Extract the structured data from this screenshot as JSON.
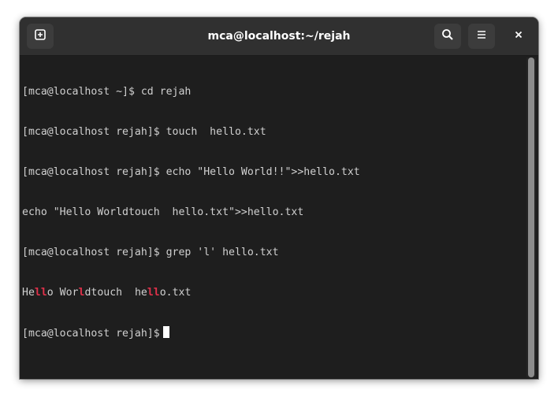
{
  "window": {
    "title": "mca@localhost:~/rejah"
  },
  "toolbar": {
    "new_tab_icon": "new-tab-icon",
    "search_icon": "search-icon",
    "menu_icon": "hamburger-menu-icon",
    "close_icon": "close-icon"
  },
  "terminal": {
    "lines": [
      "[mca@localhost ~]$ cd rejah",
      "[mca@localhost rejah]$ touch  hello.txt",
      "[mca@localhost rejah]$ echo \"Hello World!!\">>hello.txt",
      "echo \"Hello Worldtouch  hello.txt\">>hello.txt",
      "[mca@localhost rejah]$ grep 'l' hello.txt"
    ],
    "grep_result": {
      "p1": "He",
      "m1": "ll",
      "p2": "o Wor",
      "m2": "l",
      "p3": "dtouch  he",
      "m3": "ll",
      "p4": "o.txt"
    },
    "prompt": "[mca@localhost rejah]$"
  },
  "colors": {
    "background": "#1e1e1e",
    "titlebar": "#303030",
    "text": "#d0d0d0",
    "match": "#e0314a"
  }
}
